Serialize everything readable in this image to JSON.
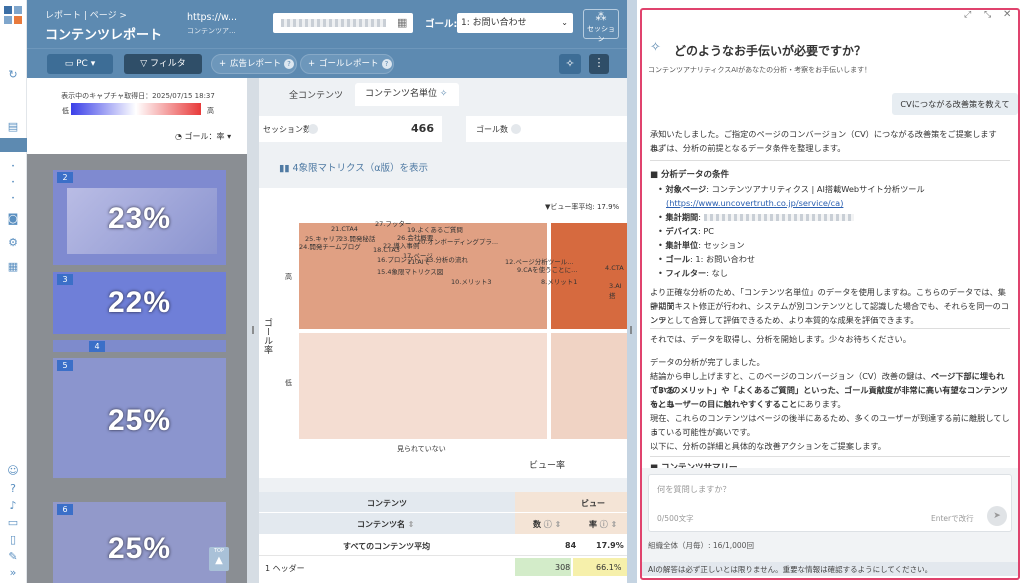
{
  "header": {
    "breadcrumb": "レポート | ページ >",
    "title": "コンテンツレポート",
    "url": "https://w...",
    "url_sub": "コンテンツア...",
    "goal_label": "ゴール:",
    "goal_value": "1: お問い合わせ",
    "session_button": "セッション"
  },
  "toolbar": {
    "device": "PC",
    "filter": "フィルタ",
    "ad_report": "広告レポート",
    "goal_report": "ゴールレポート"
  },
  "heatmap": {
    "captured_label": "表示中のキャプチャ取得日：2025/07/15 18:37",
    "low": "低",
    "high": "高",
    "goal_rate": "ゴール：率",
    "thumbnails": [
      {
        "num": "2",
        "pct": "23%"
      },
      {
        "num": "3",
        "pct": "22%"
      },
      {
        "num": "4",
        "pct": ""
      },
      {
        "num": "5",
        "pct": "25%"
      },
      {
        "num": "6",
        "pct": "25%"
      }
    ],
    "top_button": "TOP"
  },
  "center": {
    "tabs": [
      "全コンテンツ",
      "コンテンツ名単位"
    ],
    "sessions_label": "セッション数",
    "sessions_value": "466",
    "goal_count_label": "ゴール数",
    "matrix_title": "4象限マトリクス（α版）を表示",
    "view_avg": "▼ビュー率平均: 17.9%",
    "y_axis": "ゴール率",
    "y_high": "高",
    "y_low": "低",
    "x_axis": "ビュー率",
    "x_low": "見られていない",
    "points": [
      "27.フッター",
      "21.CTA4",
      "19.よくあるご質問",
      "25.キャリア",
      "23.開発秘話",
      "26.会社概要",
      "24.開発チームブログ",
      "22.導入事例",
      "20.オンボーディングプラ...",
      "18.CTA3",
      "17.ページ",
      "16.プロンプト",
      "15.4象限マトリクス図",
      "11.AIで",
      "13.分析の流れ",
      "10.メリット3",
      "12.ページ分析ツール...",
      "9.CAを使うことに...",
      "8.メリット1",
      "4.CTA",
      "3.AI搭"
    ],
    "table": {
      "group_content": "コンテンツ",
      "group_view": "ビュー",
      "col_name": "コンテンツ名",
      "col_count": "数",
      "col_rate": "率",
      "rows": [
        {
          "name": "すべてのコンテンツ平均",
          "count": "84",
          "rate": "17.9%"
        },
        {
          "name": "1 ヘッダー",
          "count": "308",
          "rate": "66.1%"
        }
      ]
    }
  },
  "assistant": {
    "title": "どのようなお手伝いが必要ですか？",
    "subtitle": "コンテンツアナリティクスAIがあなたの分析・考察をお手伝いします！",
    "user_message": "CVにつながる改善策を教えて",
    "reply_1a": "承知いたしました。ご指定のページのコンバージョン（CV）につながる改善策をご提案しますね。",
    "reply_1b": "まずは、分析の前提となるデータ条件を整理します。",
    "conditions_heading": "■ 分析データの条件",
    "conditions": [
      {
        "key": "対象ページ",
        "value": ": コンテンツアナリティクス | AI搭載Webサイト分析ツール"
      },
      {
        "key": "",
        "value": "(https://www.uncovertruth.co.jp/service/ca)"
      },
      {
        "key": "集計期間",
        "value": ":"
      },
      {
        "key": "デバイス",
        "value": ": PC"
      },
      {
        "key": "集計単位",
        "value": ": セッション"
      },
      {
        "key": "ゴール",
        "value": ": 1: お問い合わせ"
      },
      {
        "key": "フィルター",
        "value": ": なし"
      }
    ],
    "reply_2": [
      "より正確な分析のため、「コンテンツ名単位」のデータを使用しますね。こちらのデータでは、集計期間",
      "中にテキスト修正が行われ、システムが別コンテンツとして認識した場合でも、それらを同一のコンテ",
      "ンツとして合算して評価できるため、より本質的な成果を評価できます。"
    ],
    "reply_3": "それでは、データを取得し、分析を開始します。少々お待ちください。",
    "reply_4a": "データの分析が完了しました。",
    "reply_4b_pre": "結論から申し上げますと、このページのコンバージョン（CV）改善の鍵は、",
    "reply_4b_bold": "ページ下部に埋もれている",
    "reply_4c_bold": "「3つのメリット」や「よくあるご質問」といった、ゴール貢献度が非常に高い有望なコンテンツを、も",
    "reply_4d_bold": "っとユーザーの目に触れやすくすること",
    "reply_4d_post": "にあります。",
    "reply_4e": "現在、これらのコンテンツはページの後半にあるため、多くのユーザーが到達する前に離脱してしま",
    "reply_4f": "っている可能性が高いです。",
    "reply_4g": "以下に、分析の詳細と具体的な改善アクションをご提案します。",
    "summary_heading": "■ コンテンツサマリー",
    "input_placeholder": "何を質問しますか？",
    "char_count": "0/500文字",
    "enter_hint": "Enterで改行",
    "org_usage": "組織全体（月毎）: 16/1,000回",
    "disclaimer": "AIの解答は必ず正しいとは限りません。重要な情報は確認するようにしてください。"
  }
}
